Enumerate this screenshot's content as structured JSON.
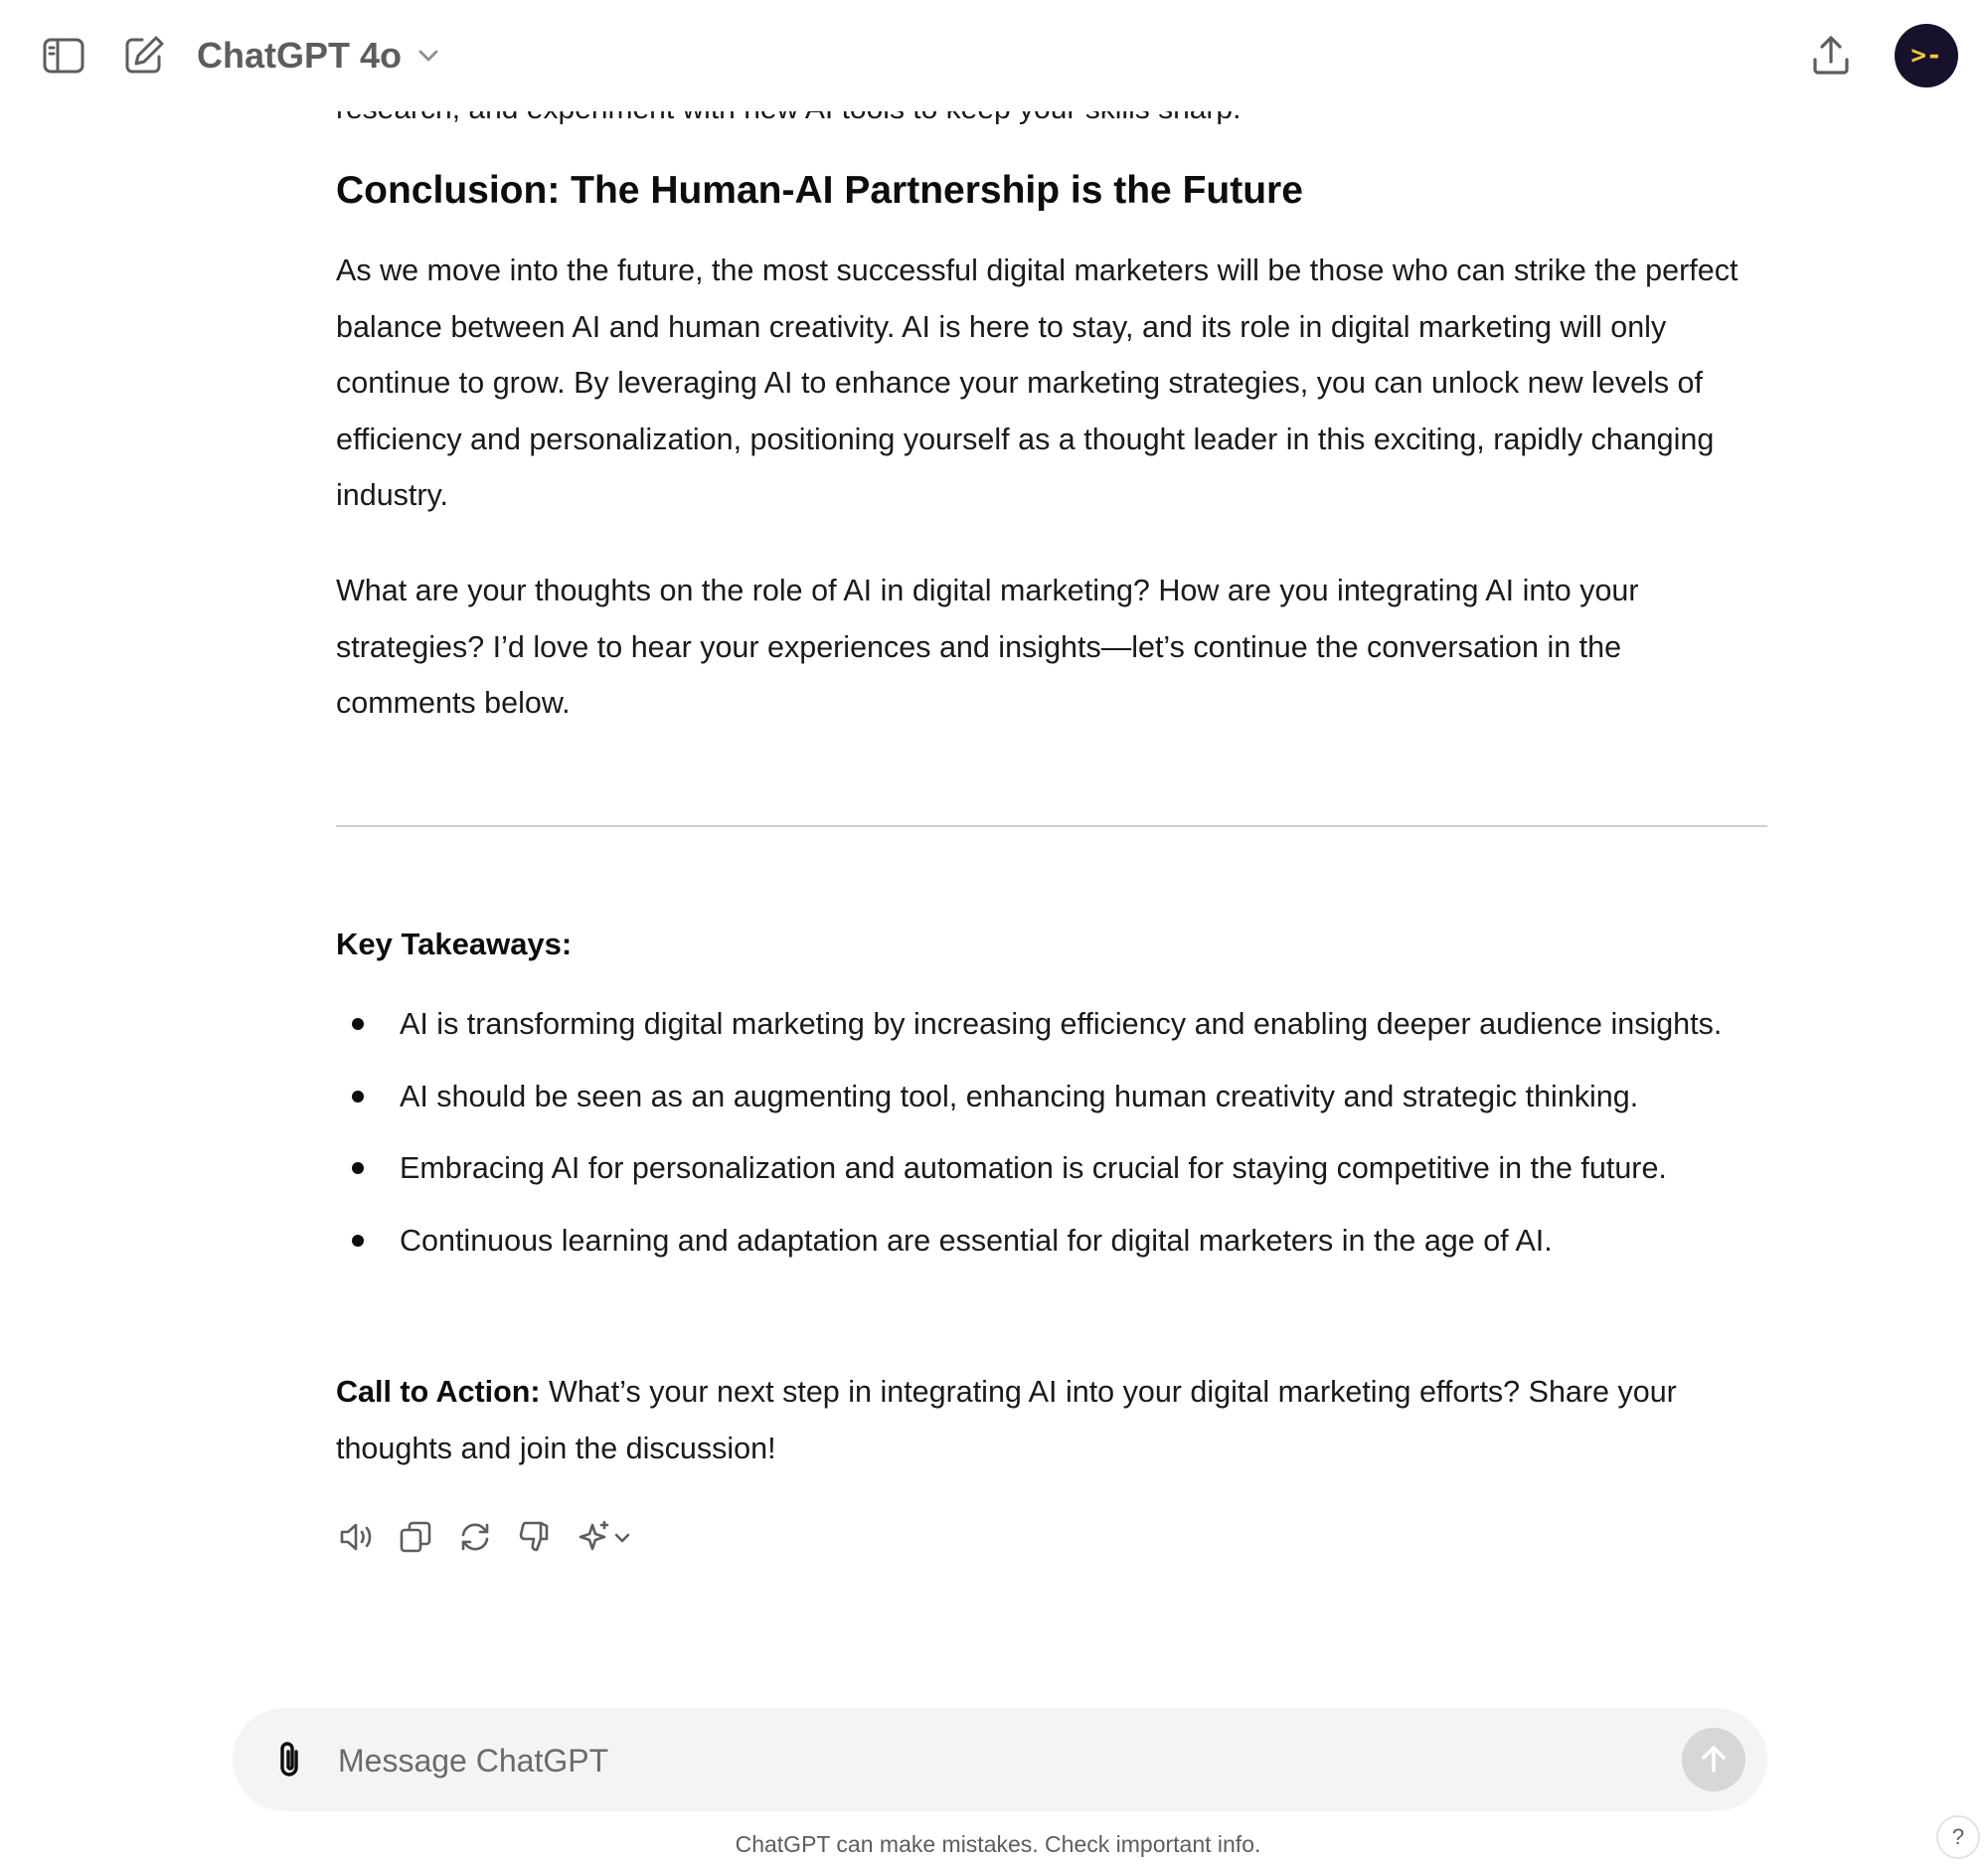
{
  "header": {
    "model_name": "ChatGPT 4o",
    "avatar_glyph": ">-",
    "icons": {
      "sidebar_toggle": "sidebar-toggle-icon",
      "new_chat": "new-chat-icon",
      "model_dropdown": "chevron-down-icon",
      "share": "share-icon"
    }
  },
  "message": {
    "clipped_line": "research, and experiment with new AI tools to keep your skills sharp.",
    "section_heading": "Conclusion: The Human-AI Partnership is the Future",
    "paragraphs": [
      "As we move into the future, the most successful digital marketers will be those who can strike the perfect balance between AI and human creativity. AI is here to stay, and its role in digital marketing will only continue to grow. By leveraging AI to enhance your marketing strategies, you can unlock new levels of efficiency and personalization, positioning yourself as a thought leader in this exciting, rapidly changing industry.",
      "What are your thoughts on the role of AI in digital marketing? How are you integrating AI into your strategies? I’d love to hear your experiences and insights—let’s continue the conversation in the comments below."
    ],
    "takeaways_heading": "Key Takeaways:",
    "takeaways": [
      "AI is transforming digital marketing by increasing efficiency and enabling deeper audience insights.",
      "AI should be seen as an augmenting tool, enhancing human creativity and strategic thinking.",
      "Embracing AI for personalization and automation is crucial for staying competitive in the future.",
      "Continuous learning and adaptation are essential for digital marketers in the age of AI."
    ],
    "cta_label": "Call to Action:",
    "cta_text": " What’s your next step in integrating AI into your digital marketing efforts? Share your thoughts and join the discussion!"
  },
  "actions": {
    "icons": [
      "read-aloud-icon",
      "copy-icon",
      "regenerate-icon",
      "thumbs-down-icon",
      "sparkle-icon"
    ]
  },
  "composer": {
    "placeholder": "Message ChatGPT",
    "value": ""
  },
  "footer": {
    "disclaimer": "ChatGPT can make mistakes. Check important info.",
    "help_label": "?"
  },
  "colors": {
    "avatar_bg": "#17112b",
    "avatar_fg": "#f4c93b",
    "composer_bg": "#f4f4f4",
    "send_disabled": "#d7d7d7"
  }
}
